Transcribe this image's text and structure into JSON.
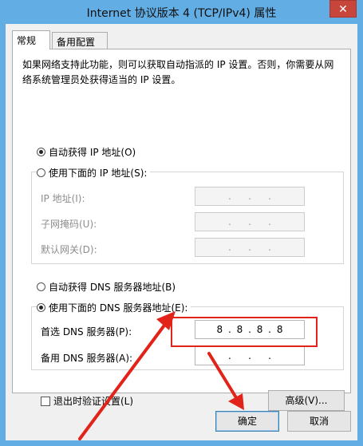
{
  "window": {
    "title": "Internet 协议版本 4 (TCP/IPv4) 属性",
    "close_glyph": "✕"
  },
  "tabs": [
    {
      "label": "常规"
    },
    {
      "label": "备用配置"
    }
  ],
  "description": "如果网络支持此功能，则可以获取自动指派的 IP 设置。否则，你需要从网络系统管理员处获得适当的 IP 设置。",
  "ip": {
    "auto_label": "自动获得 IP 地址(O)",
    "manual_label": "使用下面的 IP 地址(S):",
    "auto_selected": true,
    "fields": [
      {
        "label": "IP 地址(I):",
        "value": [
          "",
          "",
          "",
          ""
        ]
      },
      {
        "label": "子网掩码(U):",
        "value": [
          "",
          "",
          "",
          ""
        ]
      },
      {
        "label": "默认网关(D):",
        "value": [
          "",
          "",
          "",
          ""
        ]
      }
    ]
  },
  "dns": {
    "auto_label": "自动获得 DNS 服务器地址(B)",
    "manual_label": "使用下面的 DNS 服务器地址(E):",
    "manual_selected": true,
    "preferred_label": "首选 DNS 服务器(P):",
    "preferred_value": [
      "8",
      "8",
      "8",
      "8"
    ],
    "alternate_label": "备用 DNS 服务器(A):",
    "alternate_value": [
      "",
      "",
      "",
      ""
    ]
  },
  "validate_on_exit_label": "退出时验证设置(L)",
  "advanced_button": "高级(V)...",
  "ok_button": "确定",
  "cancel_button": "取消",
  "colors": {
    "annotation": "#e2231a",
    "titlebar": "#62ade4",
    "close": "#c7453a"
  }
}
